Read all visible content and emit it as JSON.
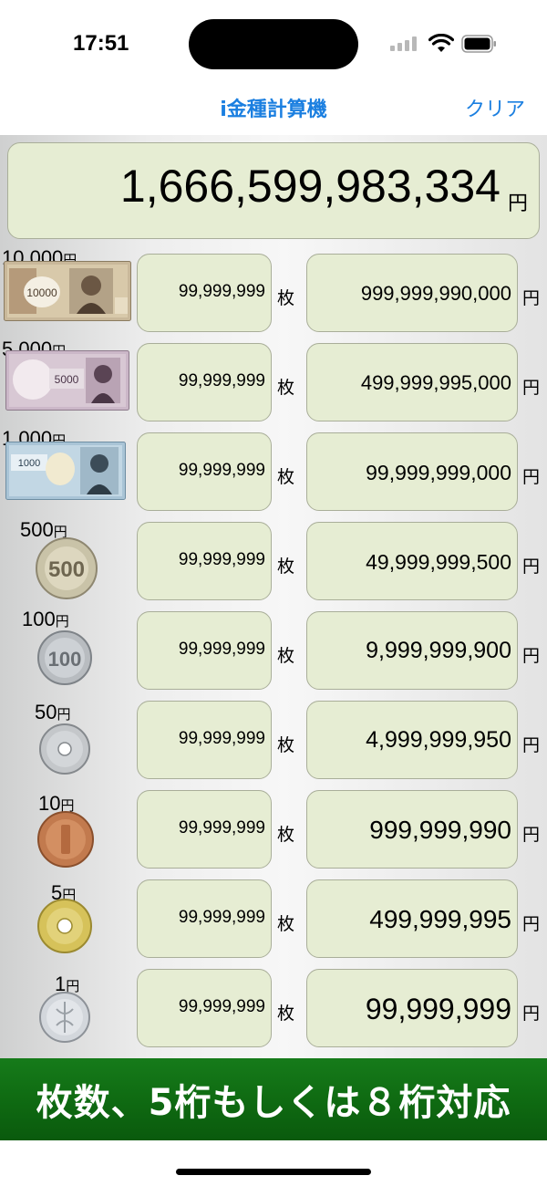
{
  "status_bar": {
    "time": "17:51"
  },
  "nav": {
    "title": "i金種計算機",
    "clear_label": "クリア"
  },
  "total": {
    "value": "1,666,599,983,334",
    "unit": "円"
  },
  "units": {
    "count": "枚",
    "yen": "円"
  },
  "rows": [
    {
      "denomination": "10,000",
      "count": "99,999,999",
      "amount": "999,999,990,000"
    },
    {
      "denomination": "5,000",
      "count": "99,999,999",
      "amount": "499,999,995,000"
    },
    {
      "denomination": "1,000",
      "count": "99,999,999",
      "amount": "99,999,999,000"
    },
    {
      "denomination": "500",
      "count": "99,999,999",
      "amount": "49,999,999,500"
    },
    {
      "denomination": "100",
      "count": "99,999,999",
      "amount": "9,999,999,900"
    },
    {
      "denomination": "50",
      "count": "99,999,999",
      "amount": "4,999,999,950"
    },
    {
      "denomination": "10",
      "count": "99,999,999",
      "amount": "999,999,990"
    },
    {
      "denomination": "5",
      "count": "99,999,999",
      "amount": "499,999,995"
    },
    {
      "denomination": "1",
      "count": "99,999,999",
      "amount": "99,999,999"
    }
  ],
  "note_prints": {
    "r0": "10000",
    "r1": "5000",
    "r2": "1000"
  },
  "coin_prints": {
    "r3": "500",
    "r4": "100"
  },
  "banner": {
    "text": "枚数、5桁もしくは８桁対応"
  },
  "colors": {
    "accent": "#1b7fe0",
    "field_bg": "#e6edd3",
    "banner_bg": "#0f6b12"
  }
}
